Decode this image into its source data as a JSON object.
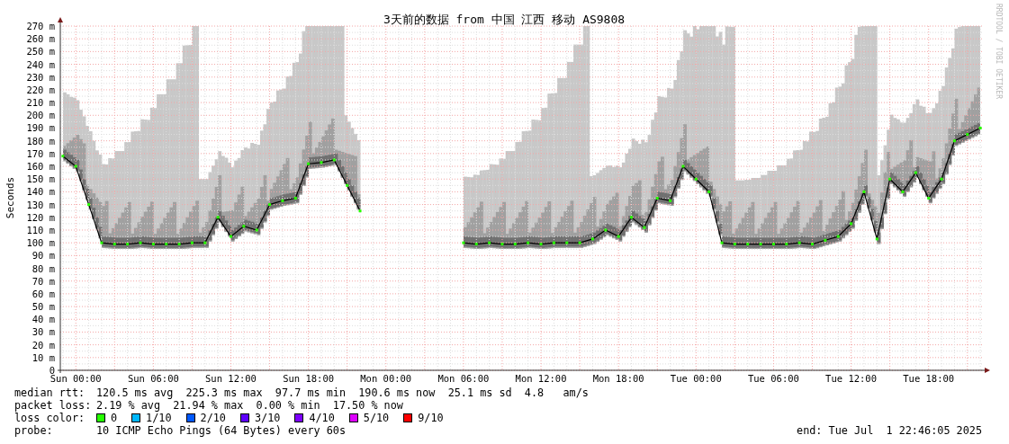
{
  "chart": {
    "credit": "RRDTOOL / TOBI OETIKER",
    "chart_data": {
      "type": "line",
      "grid": true,
      "title": "3天前的数据 from 中国 江西 移动 AS9808",
      "ylabel": "Seconds",
      "categories": [
        null,
        "Sun 00:00",
        null,
        null,
        null,
        null,
        null,
        "Sun 06:00",
        null,
        null,
        null,
        null,
        null,
        "Sun 12:00",
        null,
        null,
        null,
        null,
        null,
        "Sun 18:00",
        null,
        null,
        null,
        null,
        null,
        "Mon 00:00",
        null,
        null,
        null,
        null,
        null,
        "Mon 06:00",
        null,
        null,
        null,
        null,
        null,
        "Mon 12:00",
        null,
        null,
        null,
        null,
        null,
        "Mon 18:00",
        null,
        null,
        null,
        null,
        null,
        "Tue 00:00",
        null,
        null,
        null,
        null,
        null,
        "Tue 06:00",
        null,
        null,
        null,
        null,
        null,
        "Tue 12:00",
        null,
        null,
        null,
        null,
        null,
        "Tue 18:00",
        null,
        null,
        null,
        null
      ],
      "series": [
        {
          "color": "#000000",
          "marker": "square",
          "values": [
            168,
            160,
            130,
            100,
            99,
            99,
            100,
            99,
            99,
            99,
            100,
            100,
            120,
            105,
            113,
            110,
            130,
            133,
            135,
            162,
            163,
            165,
            145,
            125,
            null,
            null,
            null,
            null,
            null,
            null,
            null,
            100,
            99,
            100,
            99,
            99,
            100,
            99,
            100,
            100,
            100,
            103,
            110,
            105,
            120,
            112,
            135,
            133,
            160,
            150,
            140,
            100,
            99,
            99,
            99,
            99,
            99,
            100,
            99,
            102,
            105,
            115,
            140,
            103,
            150,
            140,
            155,
            135,
            150,
            180,
            185,
            190
          ]
        }
      ],
      "ylim": [
        0,
        270
      ],
      "yticks": [
        {
          "value": 0,
          "label": "0"
        },
        {
          "value": 10,
          "label": "10 m"
        },
        {
          "value": 20,
          "label": "20 m"
        },
        {
          "value": 30,
          "label": "30 m"
        },
        {
          "value": 40,
          "label": "40 m"
        },
        {
          "value": 50,
          "label": "50 m"
        },
        {
          "value": 60,
          "label": "60 m"
        },
        {
          "value": 70,
          "label": "70 m"
        },
        {
          "value": 80,
          "label": "80 m"
        },
        {
          "value": 90,
          "label": "90 m"
        },
        {
          "value": 100,
          "label": "100 m"
        },
        {
          "value": 110,
          "label": "110 m"
        },
        {
          "value": 120,
          "label": "120 m"
        },
        {
          "value": 130,
          "label": "130 m"
        },
        {
          "value": 140,
          "label": "140 m"
        },
        {
          "value": 150,
          "label": "150 m"
        },
        {
          "value": 160,
          "label": "160 m"
        },
        {
          "value": 170,
          "label": "170 m"
        },
        {
          "value": 180,
          "label": "180 m"
        },
        {
          "value": 190,
          "label": "190 m"
        },
        {
          "value": 200,
          "label": "200 m"
        },
        {
          "value": 210,
          "label": "210 m"
        },
        {
          "value": 220,
          "label": "220 m"
        },
        {
          "value": 230,
          "label": "230 m"
        },
        {
          "value": 240,
          "label": "240 m"
        },
        {
          "value": 250,
          "label": "250 m"
        },
        {
          "value": 260,
          "label": "260 m"
        },
        {
          "value": 270,
          "label": "270 m"
        }
      ]
    }
  },
  "stats": [
    {
      "label": "median rtt:",
      "value": "120.5 ms avg  225.3 ms max  97.7 ms min  190.6 ms now  25.1 ms sd  4.8   am/s"
    },
    {
      "label": "packet loss:",
      "value": "2.19 % avg  21.94 % max  0.00 % min  17.50 % now"
    }
  ],
  "loss_legend": {
    "label": "loss color:",
    "items": [
      {
        "label": "0",
        "color": "#26ff00"
      },
      {
        "label": "1/10",
        "color": "#00b8ff"
      },
      {
        "label": "2/10",
        "color": "#0059ff"
      },
      {
        "label": "3/10",
        "color": "#5e00ff"
      },
      {
        "label": "4/10",
        "color": "#7e00ff"
      },
      {
        "label": "5/10",
        "color": "#dd00ff"
      },
      {
        "label": "9/10",
        "color": "#ff0000"
      }
    ]
  },
  "probe": {
    "label": "probe:",
    "value": "10 ICMP Echo Pings (64 Bytes) every 60s"
  },
  "end": "end: Tue Jul  1 22:46:05 2025"
}
